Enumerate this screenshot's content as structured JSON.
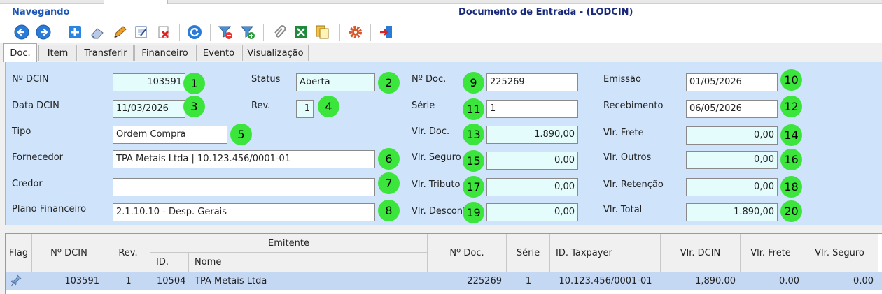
{
  "header": {
    "mode": "Navegando",
    "document_title": "Documento de Entrada - (LODCIN)"
  },
  "toolbar": {
    "buttons": [
      "back-icon",
      "forward-icon",
      "add-icon",
      "eraser-icon",
      "edit-icon",
      "edit-check-icon",
      "delete-icon",
      "refresh-icon",
      "filter-remove-icon",
      "filter-add-icon",
      "attach-icon",
      "excel-icon",
      "copy-icon",
      "settings-icon",
      "exit-icon"
    ]
  },
  "tabs": [
    "Doc.",
    "Item",
    "Transferir",
    "Financeiro",
    "Evento",
    "Visualização"
  ],
  "form": {
    "ndcin": {
      "label": "Nº DCIN",
      "value": "103591",
      "marker": "1"
    },
    "status": {
      "label": "Status",
      "value": "Aberta",
      "marker": "2"
    },
    "data_dcin": {
      "label": "Data DCIN",
      "value": "11/03/2026",
      "marker": "3"
    },
    "rev": {
      "label": "Rev.",
      "value": "1",
      "marker": "4"
    },
    "tipo": {
      "label": "Tipo",
      "value": "Ordem Compra",
      "marker": "5"
    },
    "fornecedor": {
      "label": "Fornecedor",
      "value": "TPA Metais Ltda | 10.123.456/0001-01",
      "marker": "6"
    },
    "credor": {
      "label": "Credor",
      "value": "",
      "marker": "7"
    },
    "plano": {
      "label": "Plano Financeiro",
      "value": "2.1.10.10 - Desp. Gerais",
      "marker": "8"
    },
    "ndoc": {
      "label": "Nº Doc.",
      "value": "225269",
      "marker": "9"
    },
    "emissao": {
      "label": "Emissão",
      "value": "01/05/2026",
      "marker": "10"
    },
    "serie": {
      "label": "Série",
      "value": "1",
      "marker": "11"
    },
    "recebimento": {
      "label": "Recebimento",
      "value": "06/05/2026",
      "marker": "12"
    },
    "vlr_doc": {
      "label": "Vlr. Doc.",
      "value": "1.890,00",
      "marker": "13"
    },
    "vlr_frete": {
      "label": "Vlr. Frete",
      "value": "0,00",
      "marker": "14"
    },
    "vlr_seguro": {
      "label": "Vlr. Seguro",
      "value": "0,00",
      "marker": "15"
    },
    "vlr_outros": {
      "label": "Vlr. Outros",
      "value": "0,00",
      "marker": "16"
    },
    "vlr_tributo": {
      "label": "Vlr. Tributo",
      "value": "0,00",
      "marker": "17"
    },
    "vlr_retencao": {
      "label": "Vlr. Retenção",
      "value": "0,00",
      "marker": "18"
    },
    "vlr_desconto": {
      "label": "Vlr. Descont",
      "value": "0,00",
      "marker": "19"
    },
    "vlr_total": {
      "label": "Vlr. Total",
      "value": "1.890,00",
      "marker": "20"
    }
  },
  "grid": {
    "headers": {
      "flag": "Flag",
      "ndcin": "Nº DCIN",
      "rev": "Rev.",
      "emitente": "Emitente",
      "id": "ID.",
      "nome": "Nome",
      "ndoc": "Nº Doc.",
      "serie": "Série",
      "taxpayer": "ID. Taxpayer",
      "vlr_dcin": "Vlr. DCIN",
      "vlr_frete": "Vlr. Frete",
      "vlr_seguro": "Vlr. Seguro"
    },
    "rows": [
      {
        "flag_icon": "pin-icon",
        "ndcin": "103591",
        "rev": "1",
        "id": "10504",
        "nome": "TPA Metais Ltda",
        "ndoc": "225269",
        "serie": "1",
        "taxpayer": "10.123.456/0001-01",
        "vlr_dcin": "1,890.00",
        "vlr_frete": "0.00",
        "vlr_seguro": "0.00"
      }
    ]
  },
  "colors": {
    "panel_bg": "#cfe3fa",
    "readonly_field": "#e4fdfc",
    "marker_green": "#3be53b",
    "selected_row": "#c4d7f3",
    "title_blue": "#1c55b6"
  }
}
